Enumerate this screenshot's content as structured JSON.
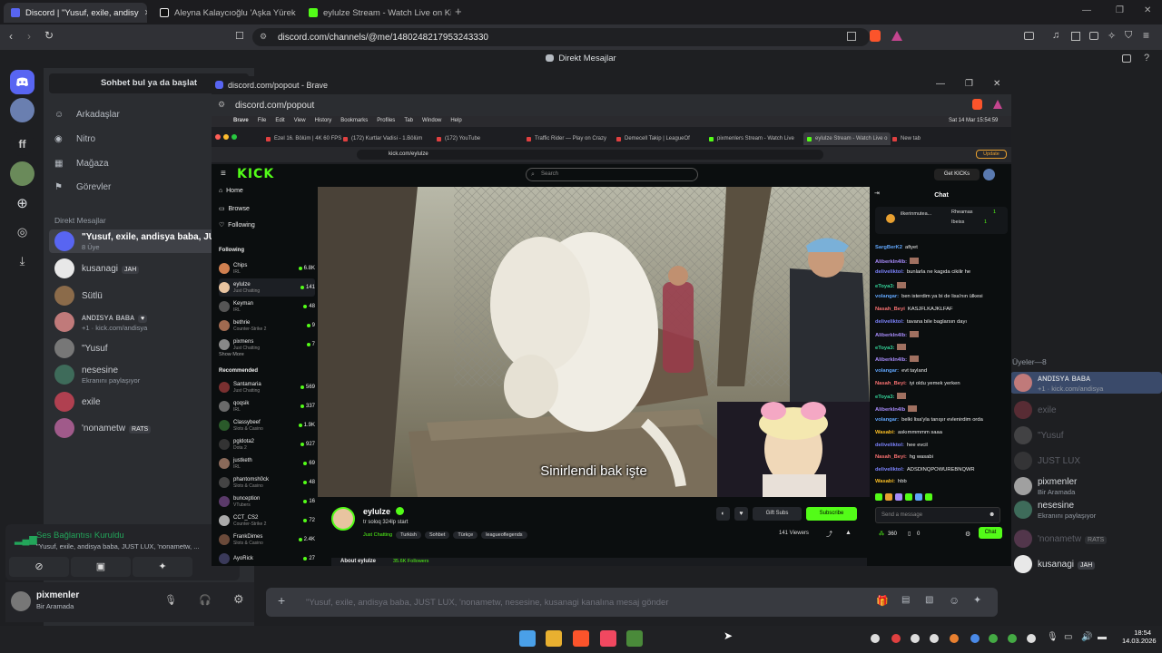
{
  "browser": {
    "tabs": [
      {
        "title": "Discord | \"Yusuf, exile, andisy",
        "active": true
      },
      {
        "title": "Aleyna Kalaycıoğlu 'Aşka Yürek Gerek'"
      },
      {
        "title": "eylulze Stream - Watch Live on Kick"
      }
    ],
    "new_tab_glyph": "+",
    "url": "discord.com/channels/@me/1480248217953243330",
    "window_controls": {
      "minimize": "—",
      "maximize": "❐",
      "close": "✕"
    }
  },
  "discord": {
    "window_title": "Direkt Mesajlar",
    "search_placeholder": "Sohbet bul ya da başlat",
    "nav": [
      {
        "label": "Arkadaşlar",
        "icon": "friends-icon"
      },
      {
        "label": "Nitro",
        "icon": "nitro-icon"
      },
      {
        "label": "Mağaza",
        "icon": "shop-icon"
      },
      {
        "label": "Görevler",
        "icon": "quests-icon"
      }
    ],
    "dm_header": "Direkt Mesajlar",
    "dms": [
      {
        "name": "\"Yusuf, exile, andisya baba, JUS",
        "sub": "8 Üye",
        "color": "#5865f2",
        "active": true
      },
      {
        "name": "kusanagi",
        "badge": "JAH",
        "sub": "",
        "color": "#e8e8e8"
      },
      {
        "name": "Sütlü",
        "sub": "",
        "color": "#8b6b4a"
      },
      {
        "name": "ᴀɴᴅɪsʏᴀ ʙᴀʙᴀ",
        "badge": "♥",
        "sub": "+1 · kick.com/andisya",
        "color": "#c07a7a"
      },
      {
        "name": "\"Yusuf",
        "sub": "",
        "color": "#777"
      },
      {
        "name": "nesesine",
        "sub": "Ekranını paylaşıyor",
        "color": "#3e6b5a"
      },
      {
        "name": "exile",
        "sub": "",
        "color": "#b04050"
      },
      {
        "name": "'nonametw",
        "badge": "RATS",
        "sub": "",
        "color": "#a05a8a"
      }
    ],
    "voice": {
      "status": "Ses Bağlantısı Kuruldu",
      "channel": "\"Yusuf, exile, andisya baba, JUST LUX, 'nonametw, ..."
    },
    "user": {
      "name": "pixmenler",
      "status": "Bir Aramada"
    },
    "message_placeholder": "\"Yusuf, exile, andisya baba, JUST LUX, 'nonametw, nesesine, kusanagi kanalına mesaj gönder",
    "members_header": "Üyeler—8",
    "members": [
      {
        "name": "ᴀɴᴅɪsʏᴀ ʙᴀʙᴀ",
        "sub": "+1 · kick.com/andisya",
        "dim": false,
        "color": "#c07a7a"
      },
      {
        "name": "exile",
        "sub": "",
        "dim": true,
        "color": "#b04050"
      },
      {
        "name": "\"Yusuf",
        "sub": "",
        "dim": true,
        "color": "#777"
      },
      {
        "name": "JUST LUX",
        "sub": "",
        "dim": true,
        "color": "#555"
      },
      {
        "name": "pixmenler",
        "sub": "Bir Aramada",
        "dim": false,
        "color": "#a0a0a0"
      },
      {
        "name": "nesesine",
        "sub": "Ekranını paylaşıyor",
        "dim": false,
        "color": "#3e6b5a"
      },
      {
        "name": "'nonametw",
        "badge": "RATS",
        "sub": "",
        "dim": true,
        "color": "#a05a8a"
      },
      {
        "name": "kusanagi",
        "badge": "JAH",
        "sub": "",
        "dim": false,
        "color": "#e8e8e8"
      }
    ]
  },
  "popout": {
    "title": "discord.com/popout - Brave",
    "url": "discord.com/popout",
    "mac": {
      "menu": [
        "Brave",
        "File",
        "Edit",
        "View",
        "History",
        "Bookmarks",
        "Profiles",
        "Tab",
        "Window",
        "Help"
      ],
      "clock": "Sat 14 Mar  15:54:59",
      "tabs": [
        "Ezel 16. Bölüm | 4K 60 FPS -",
        "(172) Kurtlar Vadisi - 1.Bölüm",
        "(172) YouTube",
        "Traffic Rider — Play on Crazy",
        "Demecell Takip | LeagueOf",
        "pixmenlers Stream - Watch Live",
        "eylulze Stream - Watch Live o",
        "New tab"
      ],
      "url": "kick.com/eylulze",
      "update": "Update"
    },
    "kick": {
      "logo": "KICK",
      "search": "Search",
      "get_kicks": "Get KICKs",
      "nav": [
        "Home",
        "Browse",
        "Following"
      ],
      "following_header": "Following",
      "following": [
        {
          "name": "Chips",
          "cat": "IRL",
          "viewers": "6.8K",
          "color": "#d08050"
        },
        {
          "name": "eylulze",
          "cat": "Just Chatting",
          "viewers": "141",
          "color": "#e8c4a0"
        },
        {
          "name": "Keyman",
          "cat": "IRL",
          "viewers": "48",
          "color": "#555"
        },
        {
          "name": "bethrie",
          "cat": "Counter-Strike 2",
          "viewers": "9",
          "color": "#a06a50"
        },
        {
          "name": "pixmens",
          "cat": "Just Chatting",
          "viewers": "7",
          "color": "#888"
        }
      ],
      "show_more": "Show More",
      "recommended_header": "Recommended",
      "recommended": [
        {
          "name": "Santamaria",
          "cat": "Just Chatting",
          "viewers": "569",
          "color": "#7a3030"
        },
        {
          "name": "qoqsik",
          "cat": "IRL",
          "viewers": "337",
          "color": "#6a6a6a"
        },
        {
          "name": "Classybeef",
          "cat": "Slots & Casino",
          "viewers": "1.9K",
          "color": "#2a5a2a"
        },
        {
          "name": "pgldota2",
          "cat": "Dota 2",
          "viewers": "927",
          "color": "#333"
        },
        {
          "name": "justketh",
          "cat": "IRL",
          "viewers": "69",
          "color": "#8a6a5a"
        },
        {
          "name": "phantomsh0ck",
          "cat": "Slots & Casino",
          "viewers": "48",
          "color": "#444"
        },
        {
          "name": "bunception",
          "cat": "VTubers",
          "viewers": "16",
          "color": "#5a3a6a"
        },
        {
          "name": "CCT_CS2",
          "cat": "Counter-Strike 2",
          "viewers": "72",
          "color": "#aaa"
        },
        {
          "name": "FrankDimes",
          "cat": "Slots & Casino",
          "viewers": "2.4K",
          "color": "#6a4a3a"
        },
        {
          "name": "AyoRick",
          "cat": "",
          "viewers": "27",
          "color": "#3a3a5a"
        }
      ],
      "subtitle": "Sinirlendi bak işte",
      "streamer": {
        "name": "eylulze",
        "title": "tr soloq 324lp start",
        "category": "Just Chatting",
        "tags": [
          "Turkish",
          "Sohbet",
          "Türkçe",
          "leagueoflegends"
        ],
        "viewers": "141 Viewers",
        "gift": "Gift Subs",
        "subscribe": "Subscribe",
        "about": "About eylulze",
        "followers": "35.6K Followers"
      },
      "chat_title": "Chat",
      "pinned": [
        {
          "name": "ilkerinmutea...",
          "val": ""
        },
        {
          "name": "Rheamas",
          "val": "1"
        },
        {
          "name": "Ibeiss",
          "val": "1"
        }
      ],
      "chat": [
        {
          "user": "SargBerK2",
          "color": "#60a5fa",
          "msg": "afiyet"
        },
        {
          "user": "AliberkIn4lb:",
          "color": "#a78bfa",
          "msg": ""
        },
        {
          "user": "deliveliktol:",
          "color": "#7c83fd",
          "msg": "bunlarla ne kagıda cikilir he"
        },
        {
          "user": "eToya3:",
          "color": "#34d399",
          "msg": ""
        },
        {
          "user": "volangar:",
          "color": "#60a5fa",
          "msg": "ben isterdim ya bi de lisa'nın ülkesi"
        },
        {
          "user": "Nasah_Beyi",
          "color": "#f87171",
          "msg": "KASJFLKAJKLFAF"
        },
        {
          "user": "deliveliktol:",
          "color": "#7c83fd",
          "msg": "tavana bile baglarsın dayı"
        },
        {
          "user": "AliberkIn4lb:",
          "color": "#a78bfa",
          "msg": ""
        },
        {
          "user": "eToya3:",
          "color": "#34d399",
          "msg": ""
        },
        {
          "user": "AliberkIn4lb:",
          "color": "#a78bfa",
          "msg": ""
        },
        {
          "user": "volangar:",
          "color": "#60a5fa",
          "msg": "evt tayland"
        },
        {
          "user": "Nasah_Beyi:",
          "color": "#f87171",
          "msg": "iyi oldu yemek yerken"
        },
        {
          "user": "eToya3:",
          "color": "#34d399",
          "msg": ""
        },
        {
          "user": "AliberkIn4lb",
          "color": "#a78bfa",
          "msg": ""
        },
        {
          "user": "volangar:",
          "color": "#60a5fa",
          "msg": "belki lisa'yla tanışır evlenirdim orda"
        },
        {
          "user": "Wasabi:",
          "color": "#fbbf24",
          "msg": "askımmmmm saaa"
        },
        {
          "user": "deliveliktol:",
          "color": "#7c83fd",
          "msg": "hee evcil"
        },
        {
          "user": "Nasah_Beyi:",
          "color": "#f87171",
          "msg": "hg wasabi"
        },
        {
          "user": "deliveliktol:",
          "color": "#7c83fd",
          "msg": "ADSDINQPOWUREBNQWR"
        },
        {
          "user": "Wasabi:",
          "color": "#fbbf24",
          "msg": "hbb"
        }
      ],
      "chat_placeholder": "Send a message",
      "points": "360",
      "chat_count": "0",
      "chat_button": "Chat"
    }
  },
  "taskbar": {
    "time": "18:54",
    "date": "14.03.2026"
  },
  "colors": {
    "kick_green": "#53fc18",
    "discord_blurple": "#5865f2"
  }
}
